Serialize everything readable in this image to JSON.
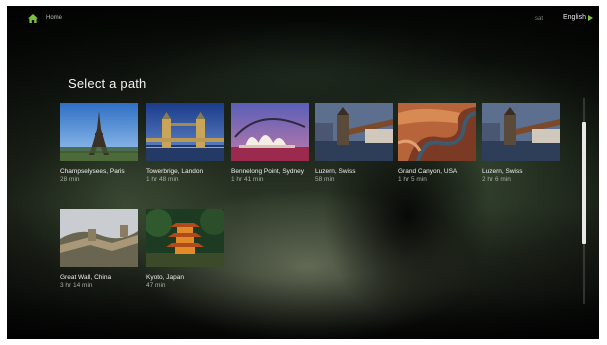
{
  "header": {
    "home_label": "Home",
    "language": "English",
    "tv_badge": "sat",
    "accent_color": "#7cc242"
  },
  "page_title": "Select a path",
  "paths": [
    {
      "name": "Champselysees, Paris",
      "duration": "28 min",
      "icon": "eiffel-tower-thumbnail"
    },
    {
      "name": "Towerbrige, Landon",
      "duration": "1 hr 48 min",
      "icon": "tower-bridge-thumbnail"
    },
    {
      "name": "Bennelong Point, Sydney",
      "duration": "1 hr 41 min",
      "icon": "sydney-opera-house-thumbnail"
    },
    {
      "name": "Luzern, Swiss",
      "duration": "58 min",
      "icon": "luzern-bridge-thumbnail"
    },
    {
      "name": "Grand Canyon, USA",
      "duration": "1 hr 5 min",
      "icon": "grand-canyon-thumbnail"
    },
    {
      "name": "Luzern, Swiss",
      "duration": "2 hr 6 min",
      "icon": "luzern-bridge-thumbnail"
    },
    {
      "name": "Great Wall, China",
      "duration": "3 hr 14 min",
      "icon": "great-wall-thumbnail"
    },
    {
      "name": "Kyoto, Japan",
      "duration": "47 min",
      "icon": "kyoto-pagoda-thumbnail"
    }
  ]
}
